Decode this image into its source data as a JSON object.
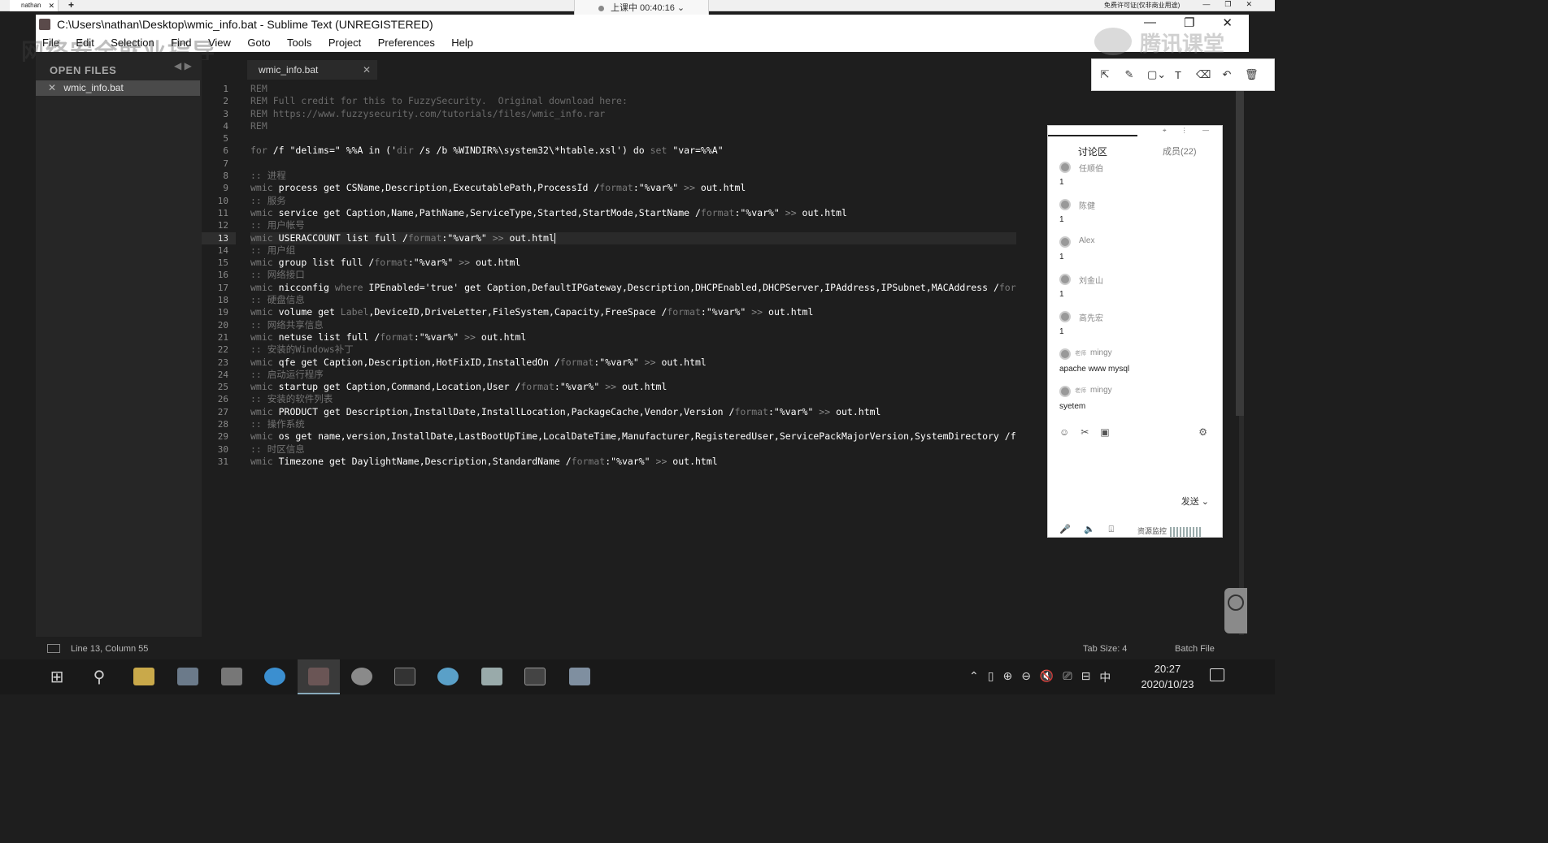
{
  "outer": {
    "tab_label": "nathan",
    "tab_close": "✕",
    "new_tab": "+",
    "right_text": "免费许可证(仅非商业用途)",
    "controls": "—❐✕"
  },
  "live_status": {
    "label": "上课中 00:40:16",
    "caret": "⌄"
  },
  "window": {
    "title": "C:\\Users\\nathan\\Desktop\\wmic_info.bat - Sublime Text (UNREGISTERED)",
    "minimize": "—",
    "maximize": "❐",
    "close": "✕"
  },
  "menu": [
    "File",
    "Edit",
    "Selection",
    "Find",
    "View",
    "Goto",
    "Tools",
    "Project",
    "Preferences",
    "Help"
  ],
  "watermark_text": "网络安全就业指导",
  "logo_text": "腾讯课堂",
  "sidebar": {
    "nav_arrows": "◀ ▶",
    "heading": "OPEN FILES",
    "file_close": "✕",
    "file": "wmic_info.bat"
  },
  "tab": {
    "label": "wmic_info.bat",
    "close": "✕"
  },
  "editor": {
    "current_line": 13,
    "lines": [
      [
        [
          "rem",
          "REM"
        ]
      ],
      [
        [
          "rem",
          "REM Full credit for this to FuzzySecurity.  Original download here:"
        ]
      ],
      [
        [
          "rem",
          "REM https://www.fuzzysecurity.com/tutorials/files/wmic_info.rar"
        ]
      ],
      [
        [
          "rem",
          "REM"
        ]
      ],
      [],
      [
        [
          "dim",
          "for"
        ],
        [
          "t",
          " /f \"delims=\" %%A in ('"
        ],
        [
          "dim",
          "dir"
        ],
        [
          "t",
          " /s /b %WINDIR%\\system32\\*htable.xsl') do "
        ],
        [
          "dim",
          "set"
        ],
        [
          "t",
          " \"var=%%A\""
        ]
      ],
      [],
      [
        [
          "cmt",
          ":: 进程"
        ]
      ],
      [
        [
          "dim",
          "wmic"
        ],
        [
          "t",
          " process get CSName,Description,ExecutablePath,ProcessId /"
        ],
        [
          "dim",
          "format"
        ],
        [
          "t",
          ":\"%var%\" "
        ],
        [
          "op",
          ">>"
        ],
        [
          "t",
          " out.html"
        ]
      ],
      [
        [
          "cmt",
          ":: 服务"
        ]
      ],
      [
        [
          "dim",
          "wmic"
        ],
        [
          "t",
          " service get Caption,Name,PathName,ServiceType,Started,StartMode,StartName /"
        ],
        [
          "dim",
          "format"
        ],
        [
          "t",
          ":\"%var%\" "
        ],
        [
          "op",
          ">>"
        ],
        [
          "t",
          " out.html"
        ]
      ],
      [
        [
          "cmt",
          ":: 用户帐号"
        ]
      ],
      [
        [
          "dim",
          "wmic"
        ],
        [
          "t",
          " USERACCOUNT list full /"
        ],
        [
          "dim",
          "format"
        ],
        [
          "t",
          ":\"%var%\" "
        ],
        [
          "op",
          ">>"
        ],
        [
          "t",
          " out.html"
        ]
      ],
      [
        [
          "cmt",
          ":: 用户组"
        ]
      ],
      [
        [
          "dim",
          "wmic"
        ],
        [
          "t",
          " group list full /"
        ],
        [
          "dim",
          "format"
        ],
        [
          "t",
          ":\"%var%\" "
        ],
        [
          "op",
          ">>"
        ],
        [
          "t",
          " out.html"
        ]
      ],
      [
        [
          "cmt",
          ":: 网络接口"
        ]
      ],
      [
        [
          "dim",
          "wmic"
        ],
        [
          "t",
          " nicconfig "
        ],
        [
          "dim",
          "where"
        ],
        [
          "t",
          " IPEnabled='true' get Caption,DefaultIPGateway,Description,DHCPEnabled,DHCPServer,IPAddress,IPSubnet,MACAddress /"
        ],
        [
          "dim",
          "for"
        ]
      ],
      [
        [
          "cmt",
          ":: 硬盘信息"
        ]
      ],
      [
        [
          "dim",
          "wmic"
        ],
        [
          "t",
          " volume get "
        ],
        [
          "dim",
          "Label"
        ],
        [
          "t",
          ",DeviceID,DriveLetter,FileSystem,Capacity,FreeSpace /"
        ],
        [
          "dim",
          "format"
        ],
        [
          "t",
          ":\"%var%\" "
        ],
        [
          "op",
          ">>"
        ],
        [
          "t",
          " out.html"
        ]
      ],
      [
        [
          "cmt",
          ":: 网络共享信息"
        ]
      ],
      [
        [
          "dim",
          "wmic"
        ],
        [
          "t",
          " netuse list full /"
        ],
        [
          "dim",
          "format"
        ],
        [
          "t",
          ":\"%var%\" "
        ],
        [
          "op",
          ">>"
        ],
        [
          "t",
          " out.html"
        ]
      ],
      [
        [
          "cmt",
          ":: 安装的Windows补丁"
        ]
      ],
      [
        [
          "dim",
          "wmic"
        ],
        [
          "t",
          " qfe get Caption,Description,HotFixID,InstalledOn /"
        ],
        [
          "dim",
          "format"
        ],
        [
          "t",
          ":\"%var%\" "
        ],
        [
          "op",
          ">>"
        ],
        [
          "t",
          " out.html"
        ]
      ],
      [
        [
          "cmt",
          ":: 启动运行程序"
        ]
      ],
      [
        [
          "dim",
          "wmic"
        ],
        [
          "t",
          " startup get Caption,Command,Location,User /"
        ],
        [
          "dim",
          "format"
        ],
        [
          "t",
          ":\"%var%\" "
        ],
        [
          "op",
          ">>"
        ],
        [
          "t",
          " out.html"
        ]
      ],
      [
        [
          "cmt",
          ":: 安装的软件列表"
        ]
      ],
      [
        [
          "dim",
          "wmic"
        ],
        [
          "t",
          " PRODUCT get Description,InstallDate,InstallLocation,PackageCache,Vendor,Version /"
        ],
        [
          "dim",
          "format"
        ],
        [
          "t",
          ":\"%var%\" "
        ],
        [
          "op",
          ">>"
        ],
        [
          "t",
          " out.html"
        ]
      ],
      [
        [
          "cmt",
          ":: 操作系统"
        ]
      ],
      [
        [
          "dim",
          "wmic"
        ],
        [
          "t",
          " os get name,version,InstallDate,LastBootUpTime,LocalDateTime,Manufacturer,RegisteredUser,ServicePackMajorVersion,SystemDirectory /f"
        ]
      ],
      [
        [
          "cmt",
          ":: 时区信息"
        ]
      ],
      [
        [
          "dim",
          "wmic"
        ],
        [
          "t",
          " Timezone get DaylightName,Description,StandardName /"
        ],
        [
          "dim",
          "format"
        ],
        [
          "t",
          ":\"%var%\" "
        ],
        [
          "op",
          ">>"
        ],
        [
          "t",
          " out.html"
        ]
      ]
    ]
  },
  "annotation_toolbar": [
    "⇱",
    "✎",
    "▢⌄",
    "T",
    "⌫",
    "↶",
    "🗑"
  ],
  "chat": {
    "top_icons": "⌖ ⋮ —",
    "tab_discuss": "讨论区",
    "tab_members": "成员(22)",
    "messages": [
      {
        "role": "",
        "name": "任顺伯",
        "body": "1"
      },
      {
        "role": "",
        "name": "陈健",
        "body": "1"
      },
      {
        "role": "",
        "name": "Alex",
        "body": "1"
      },
      {
        "role": "",
        "name": "刘金山",
        "body": "1"
      },
      {
        "role": "",
        "name": "高先宏",
        "body": "1"
      },
      {
        "role": "老师",
        "name": "mingy",
        "body": "apache www mysql"
      },
      {
        "role": "老师",
        "name": "mingy",
        "body": "syetem"
      }
    ],
    "tools": [
      "☺",
      "✂",
      "▣"
    ],
    "settings": "⚙",
    "send": "发送 ⌄",
    "bottom_icons": [
      "🎤",
      "🔈",
      "⍗"
    ],
    "resource_monitor": "资源监控"
  },
  "status": {
    "position": "Line 13, Column 55",
    "tab_size": "Tab Size: 4",
    "syntax": "Batch File"
  },
  "taskbar": {
    "start": "⊞",
    "search": "⚲",
    "tray": [
      "⌃",
      "▯",
      "⊕",
      "⊖",
      "🔇",
      "⎚",
      "⊟",
      "中"
    ],
    "time": "20:27",
    "date": "2020/10/23"
  }
}
